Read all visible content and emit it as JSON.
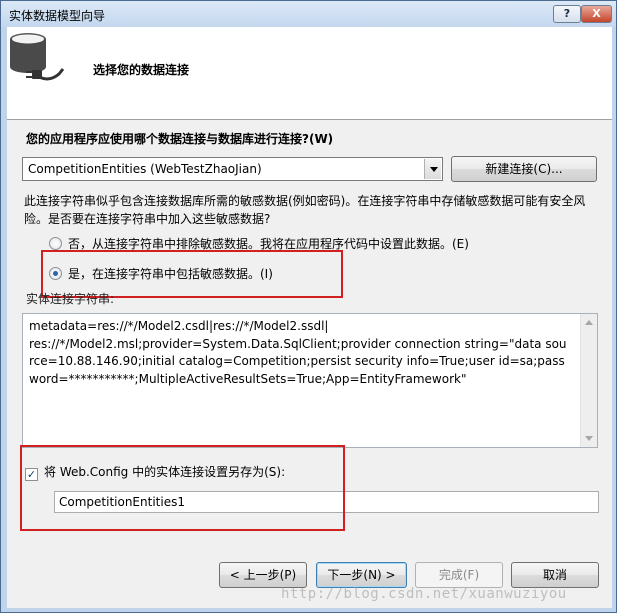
{
  "window": {
    "title": "实体数据模型向导",
    "help_label": "?",
    "close_label": "X"
  },
  "header": {
    "title": "选择您的数据连接",
    "icon": "database-plug-icon"
  },
  "question": "您的应用程序应使用哪个数据连接与数据库进行连接?(W)",
  "connection_select": {
    "selected": "CompetitionEntities (WebTestZhaoJian)"
  },
  "new_connection_button": "新建连接(C)...",
  "sensitive_text": "此连接字符串似乎包含连接数据库所需的敏感数据(例如密码)。在连接字符串中存储敏感数据可能有安全风险。是否要在连接字符串中加入这些敏感数据?",
  "radios": [
    {
      "label": "否，从连接字符串中排除敏感数据。我将在应用程序代码中设置此数据。(E)",
      "checked": false
    },
    {
      "label": "是，在连接字符串中包括敏感数据。(I)",
      "checked": true
    }
  ],
  "connection_string_label": "实体连接字符串:",
  "connection_string": "metadata=res://*/Model2.csdl|res://*/Model2.ssdl|\nres://*/Model2.msl;provider=System.Data.SqlClient;provider connection string=\"data source=10.88.146.90;initial catalog=Competition;persist security info=True;user id=sa;password=***********;MultipleActiveResultSets=True;App=EntityFramework\"",
  "save_checkbox": {
    "label": "将 Web.Config 中的实体连接设置另存为(S):",
    "checked": true
  },
  "save_name": "CompetitionEntities1",
  "footer": {
    "back": "< 上一步(P)",
    "next": "下一步(N) >",
    "finish": "完成(F)",
    "cancel": "取消"
  },
  "watermark": "http://blog.csdn.net/xuanwuziyou",
  "colors": {
    "highlight_box": "#d21f1f",
    "radio_dot": "#2c62a8"
  }
}
